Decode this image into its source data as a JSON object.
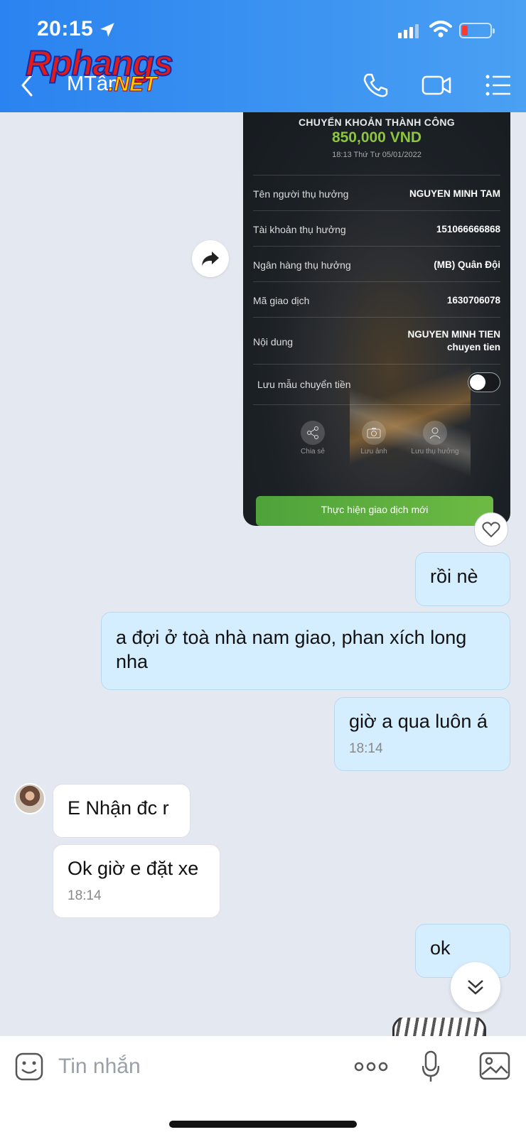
{
  "status_bar": {
    "time": "20:15"
  },
  "header": {
    "title": "MTâm"
  },
  "watermark": {
    "main": "Rphangs",
    "net": ".NET"
  },
  "receipt": {
    "heading": "CHUYỂN KHOẢN THÀNH CÔNG",
    "amount": "850,000 VND",
    "datetime": "18:13 Thứ Tư 05/01/2022",
    "rows": [
      {
        "label": "Tên người thụ hưởng",
        "value": "NGUYEN MINH TAM"
      },
      {
        "label": "Tài khoản thụ hưởng",
        "value": "151066666868"
      },
      {
        "label": "Ngân hàng thụ hưởng",
        "value": "(MB) Quân Đội"
      },
      {
        "label": "Mã giao dịch",
        "value": "1630706078"
      },
      {
        "label": "Nội dung",
        "value": "NGUYEN MINH TIEN",
        "value2": "chuyen tien"
      }
    ],
    "save_template_label": "Lưu mẫu chuyển tiền",
    "actions": {
      "share": "Chia sẻ",
      "save_image": "Lưu ảnh",
      "save_beneficiary": "Lưu thụ hưởng"
    },
    "new_transaction_button": "Thực hiện giao dịch mới"
  },
  "messages": [
    {
      "from": "me",
      "text": "rồi nè"
    },
    {
      "from": "me",
      "text": "a đợi ở toà nhà nam giao, phan xích long nha"
    },
    {
      "from": "me",
      "text": "giờ a qua luôn á",
      "time": "18:14"
    },
    {
      "from": "them",
      "text": "E Nhận đc r"
    },
    {
      "from": "them",
      "text": "Ok giờ e đặt xe",
      "time": "18:14"
    },
    {
      "from": "me",
      "text": "ok"
    }
  ],
  "input": {
    "placeholder": "Tin nhắn"
  },
  "colors": {
    "header": "#2a83f0",
    "my_bubble": "#d5eeff",
    "amount": "#8cc63f",
    "button_green": "#5fae3e"
  }
}
